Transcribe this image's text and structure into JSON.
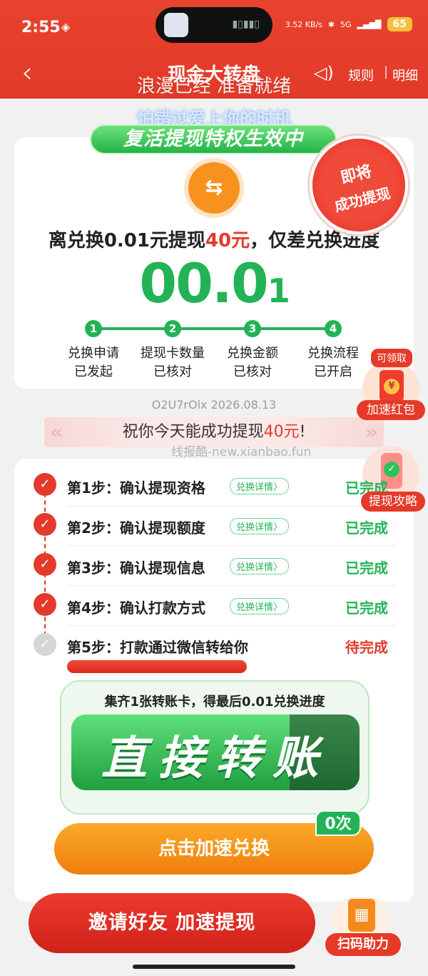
{
  "status_bar": {
    "time": "2:55",
    "net_speed": "3.52 KB/s",
    "signal": "5G",
    "battery": "65"
  },
  "nav": {
    "title": "现金大转盘",
    "rules": "规则",
    "separator": "|",
    "detail": "明细"
  },
  "lyrics": {
    "line1": "浪漫已经 准备就绪",
    "line2": "怕错过爱上你的时机"
  },
  "banner": {
    "text": "复活提现特权生效中"
  },
  "stamp": {
    "line1": "即将",
    "line2": "成功提现"
  },
  "swap_icon_glyph": "⇆",
  "progress": {
    "prefix": "离兑换0.01元提现",
    "amount": "40元",
    "suffix": "，仅差兑换进度",
    "value_main": "00.0",
    "value_small": "1"
  },
  "milestones": [
    {
      "num": "1",
      "line1": "兑换申请",
      "line2": "已发起"
    },
    {
      "num": "2",
      "line1": "提现卡数量",
      "line2": "已核对"
    },
    {
      "num": "3",
      "line1": "兑换金额",
      "line2": "已核对"
    },
    {
      "num": "4",
      "line1": "兑换流程",
      "line2": "已开启"
    }
  ],
  "float_redpacket": {
    "badge": "可领取",
    "coin": "¥",
    "label": "加速红包"
  },
  "float_guide": {
    "label": "提现攻略"
  },
  "code_line": "O2U7rOlx 2026.08.13",
  "wish": {
    "prefix": "祝你今天能成功提现",
    "amount": "40元",
    "suffix": "!"
  },
  "watermark": "线报酷-new.xianbao.fun",
  "steps": [
    {
      "label": "第1步：确认提现资格",
      "chip": "兑换详情〉",
      "status": "已完成",
      "done": true
    },
    {
      "label": "第2步：确认提现额度",
      "chip": "兑换详情〉",
      "status": "已完成",
      "done": true
    },
    {
      "label": "第3步：确认提现信息",
      "chip": "兑换详情〉",
      "status": "已完成",
      "done": true
    },
    {
      "label": "第4步：确认打款方式",
      "chip": "兑换详情〉",
      "status": "已完成",
      "done": true
    },
    {
      "label": "第5步：打款通过微信转给你",
      "chip": "",
      "status": "待完成",
      "done": false
    }
  ],
  "transfer": {
    "title": "集齐1张转账卡，得最后0.01兑换进度",
    "banner": "直接转账"
  },
  "speed_button": {
    "label": "点击加速兑换",
    "count": "0次"
  },
  "invite_button": {
    "label": "邀请好友 加速提现"
  },
  "scan": {
    "label": "扫码助力"
  },
  "colors": {
    "brand_red": "#e33a2c",
    "green": "#23b356",
    "orange": "#f48a1e"
  }
}
